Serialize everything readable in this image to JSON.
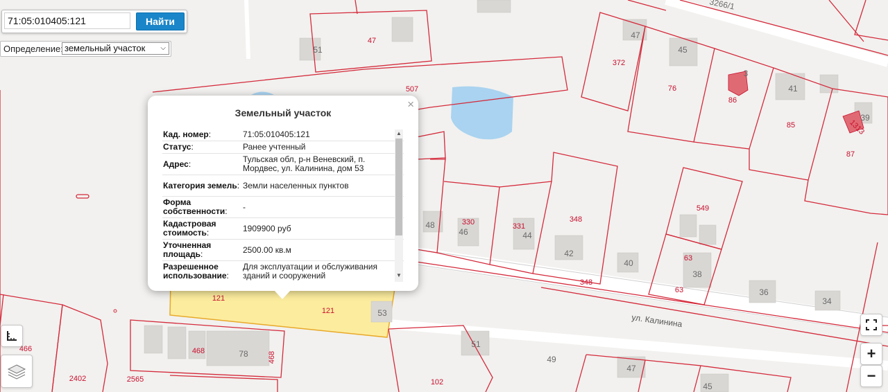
{
  "search": {
    "value": "71:05:010405:121",
    "button_label": "Найти"
  },
  "definition": {
    "label": "Определение:",
    "selected": "земельный участок"
  },
  "popup": {
    "title": "Земельный участок",
    "close": "×",
    "rows": [
      {
        "key": "Кад. номер",
        "suffix": ":",
        "value": "71:05:010405:121"
      },
      {
        "key": "Статус",
        "suffix": ":",
        "value": "Ранее учтенный"
      },
      {
        "key": "Адрес",
        "suffix": ":",
        "value": "Тульская обл, р-н Веневский, п. Мордвес, ул. Калинина, дом 53"
      },
      {
        "key": "Категория земель",
        "suffix": ":",
        "value": "Земли населенных пунктов"
      },
      {
        "key": "Форма собственности",
        "suffix": ":",
        "value": "-"
      },
      {
        "key": "Кадастровая стоимость",
        "suffix": ":",
        "value": "1909900 руб"
      },
      {
        "key": "Уточненная площадь",
        "suffix": ":",
        "value": "2500.00 кв.м"
      },
      {
        "key": "Разрешенное использование",
        "suffix": ":",
        "value": "Для эксплуатации и обслуживания зданий и сооружений"
      }
    ]
  },
  "map": {
    "street": "ул. Калинина",
    "colors": {
      "parcel_line": "#d42a3b",
      "selected_fill": "#fcec9e",
      "selected_line": "#e8a928",
      "water": "#a9d3f0",
      "building": "#d9d7d4"
    },
    "labels": [
      {
        "t": "51",
        "c": "gray"
      },
      {
        "t": "47",
        "c": "red"
      },
      {
        "t": "507",
        "c": "red"
      },
      {
        "t": "3266/1",
        "c": "gray"
      },
      {
        "t": "47",
        "c": "gray"
      },
      {
        "t": "45",
        "c": "gray"
      },
      {
        "t": "372",
        "c": "red"
      },
      {
        "t": "76",
        "c": "red"
      },
      {
        "t": "3",
        "c": "gray"
      },
      {
        "t": "86",
        "c": "red"
      },
      {
        "t": "41",
        "c": "gray"
      },
      {
        "t": "85",
        "c": "red"
      },
      {
        "t": "39",
        "c": "gray"
      },
      {
        "t": "1313",
        "c": "red"
      },
      {
        "t": "87",
        "c": "red"
      },
      {
        "t": "549",
        "c": "red"
      },
      {
        "t": "348",
        "c": "red"
      },
      {
        "t": "330",
        "c": "red"
      },
      {
        "t": "331",
        "c": "red"
      },
      {
        "t": "48",
        "c": "gray"
      },
      {
        "t": "46",
        "c": "gray"
      },
      {
        "t": "44",
        "c": "gray"
      },
      {
        "t": "42",
        "c": "gray"
      },
      {
        "t": "40",
        "c": "gray"
      },
      {
        "t": "63",
        "c": "red"
      },
      {
        "t": "38",
        "c": "gray"
      },
      {
        "t": "63",
        "c": "red"
      },
      {
        "t": "348",
        "c": "red"
      },
      {
        "t": "36",
        "c": "gray"
      },
      {
        "t": "34",
        "c": "gray"
      },
      {
        "t": "121",
        "c": "red"
      },
      {
        "t": "121",
        "c": "red"
      },
      {
        "t": "53",
        "c": "gray"
      },
      {
        "t": "466",
        "c": "red"
      },
      {
        "t": "468",
        "c": "red"
      },
      {
        "t": "78",
        "c": "gray"
      },
      {
        "t": "468",
        "c": "red"
      },
      {
        "t": "2402",
        "c": "red"
      },
      {
        "t": "2565",
        "c": "red"
      },
      {
        "t": "51",
        "c": "gray"
      },
      {
        "t": "49",
        "c": "gray"
      },
      {
        "t": "102",
        "c": "red"
      },
      {
        "t": "47",
        "c": "gray"
      },
      {
        "t": "45",
        "c": "gray"
      }
    ]
  },
  "controls": {
    "zoom_in": "+",
    "zoom_out": "−"
  }
}
